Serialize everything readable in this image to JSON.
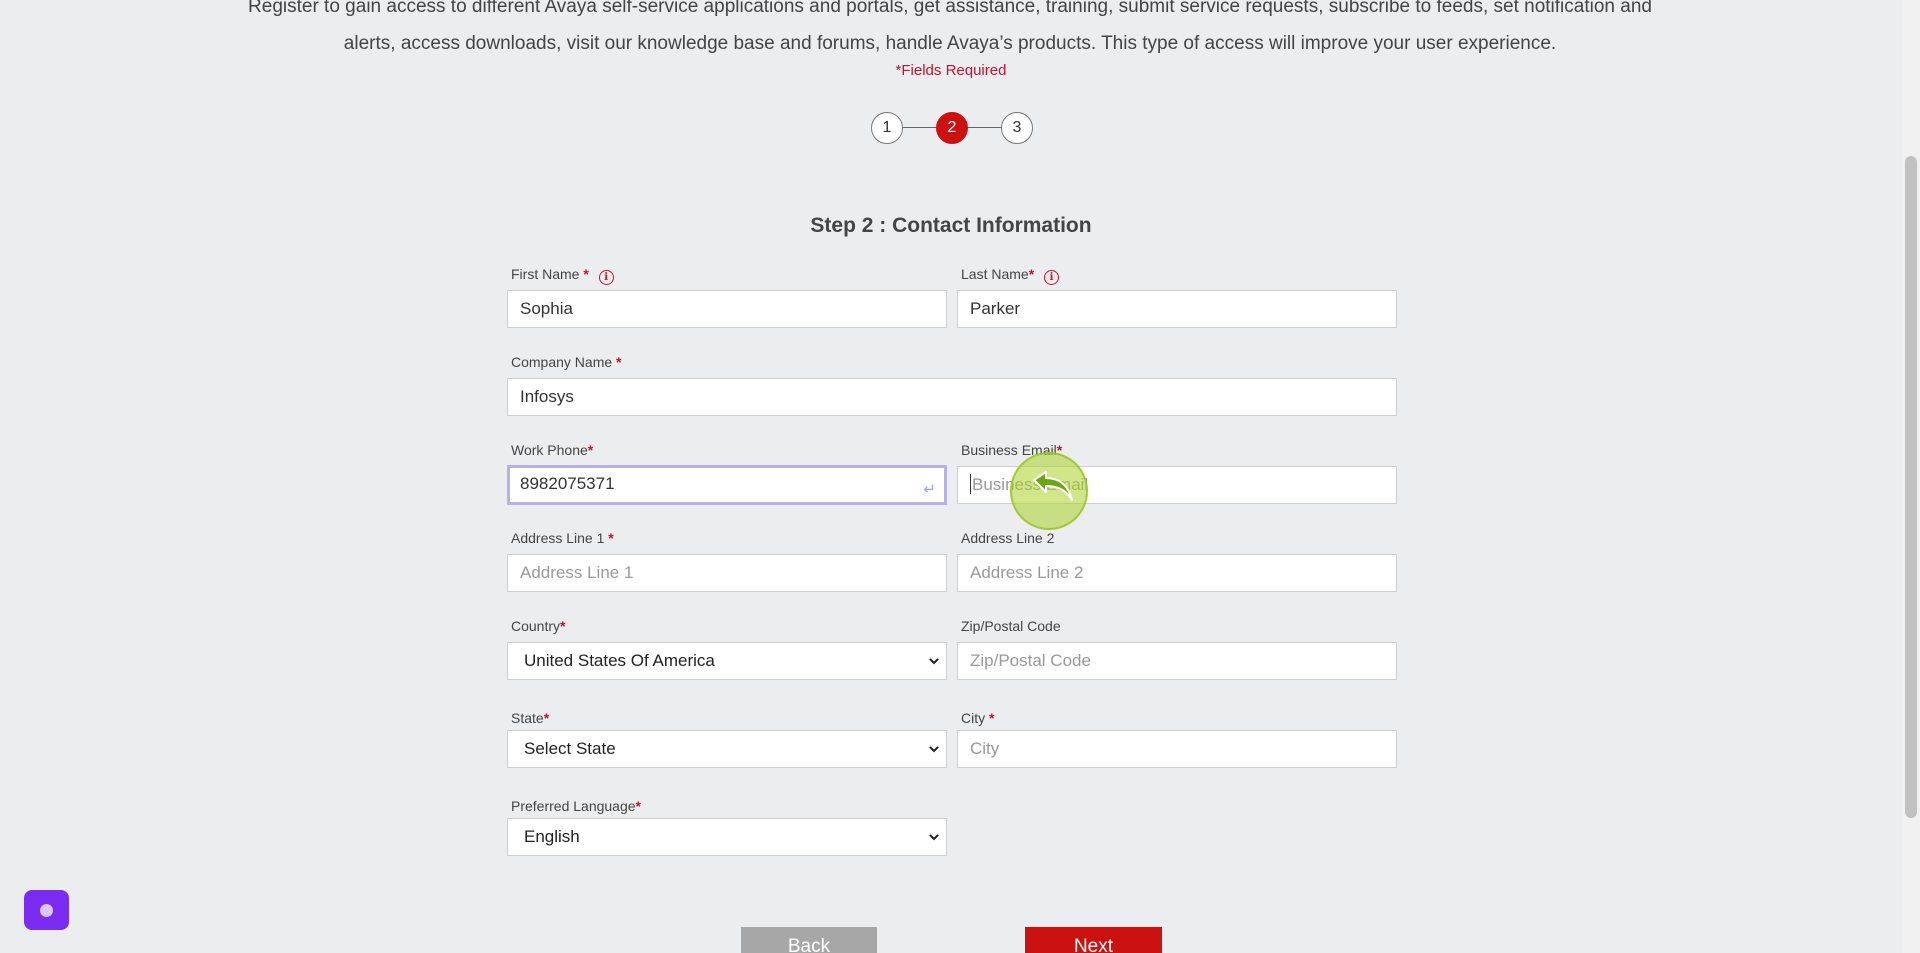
{
  "intro": {
    "line1": "Register to gain access to different Avaya self-service applications and portals, get assistance, training, submit service requests, subscribe to feeds, set notification and",
    "line2": "alerts, access downloads, visit our knowledge base and forums, handle Avaya’s products. This type of access will improve your user experience."
  },
  "fields_required": "*Fields Required",
  "stepper": {
    "steps": [
      "1",
      "2",
      "3"
    ],
    "active_index": 1,
    "active_color": "#cc1111"
  },
  "step_title": "Step 2 : Contact Information",
  "required_marker": "*",
  "form": {
    "first_name": {
      "label": "First Name",
      "value": "Sophia"
    },
    "last_name": {
      "label": "Last Name",
      "value": "Parker"
    },
    "company_name": {
      "label": "Company Name",
      "value": "Infosys"
    },
    "work_phone": {
      "label": "Work Phone",
      "value": "8982075371"
    },
    "business_email": {
      "label": "Business Email",
      "placeholder": "Business Email"
    },
    "address_line_1": {
      "label": "Address Line 1",
      "placeholder": "Address Line 1"
    },
    "address_line_2": {
      "label": "Address Line 2",
      "placeholder": "Address Line 2"
    },
    "country": {
      "label": "Country",
      "selected": "United States Of America"
    },
    "zip": {
      "label": "Zip/Postal Code",
      "placeholder": "Zip/Postal Code"
    },
    "state": {
      "label": "State",
      "selected": "Select State"
    },
    "city": {
      "label": "City",
      "placeholder": "City"
    },
    "preferred_language": {
      "label": "Preferred Language",
      "selected": "English"
    }
  },
  "buttons": {
    "back": "Back",
    "next": "Next"
  },
  "colors": {
    "accent_red": "#cc1111",
    "chat_widget": "#7b2cf0",
    "focus_border": "#b9b0ea"
  },
  "icons": {
    "info": "info-circle-icon",
    "enter": "enter-return-icon",
    "chevron": "chevron-down-icon",
    "chat": "chat-widget-icon"
  }
}
